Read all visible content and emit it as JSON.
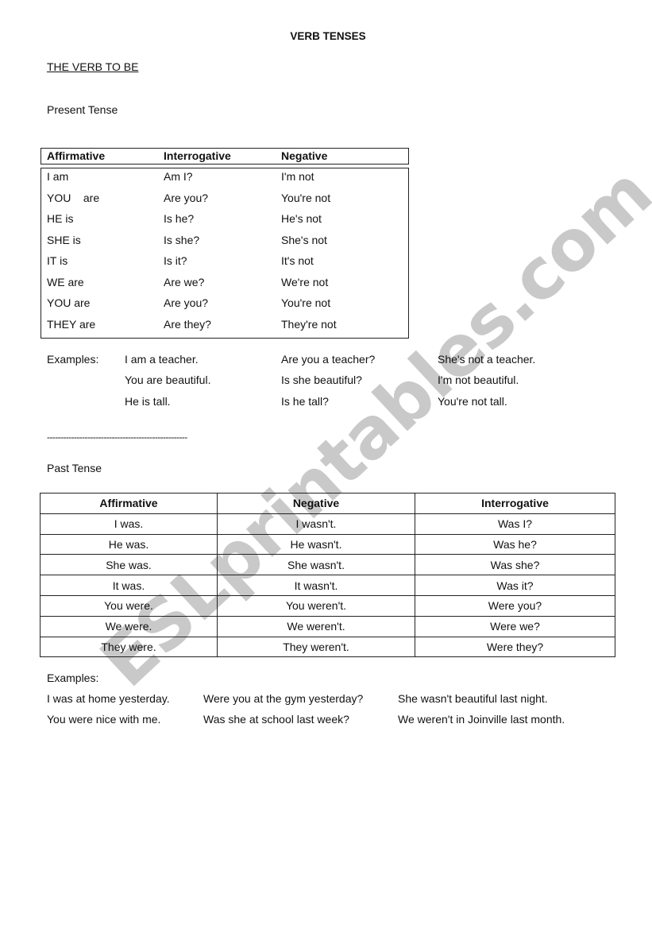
{
  "watermark": "ESLprintables.com",
  "title": "VERB TENSES",
  "subtitle": "THE VERB TO BE",
  "present": {
    "heading": "Present Tense",
    "columns": [
      "Affirmative",
      "Interrogative",
      "Negative"
    ],
    "rows": [
      [
        "I am",
        "Am I?",
        "I'm not"
      ],
      [
        "YOU    are",
        "Are you?",
        "You're not"
      ],
      [
        "HE is",
        "Is he?",
        "He's not"
      ],
      [
        "SHE is",
        "Is she?",
        "She's not"
      ],
      [
        "IT is",
        "Is it?",
        "It's not"
      ],
      [
        "WE are",
        "Are we?",
        "We're not"
      ],
      [
        "YOU are",
        "Are you?",
        "You're not"
      ],
      [
        "THEY are",
        "Are they?",
        "They're not"
      ]
    ],
    "examples_label": "Examples:",
    "examples": [
      [
        "I am a teacher.",
        "Are you a teacher?",
        "She's not a teacher."
      ],
      [
        "You are beautiful.",
        "Is she beautiful?",
        "I'm not beautiful."
      ],
      [
        "He is tall.",
        "Is he tall?",
        "You're not tall."
      ]
    ]
  },
  "divider": "----------------------------------------------------",
  "past": {
    "heading": "Past Tense",
    "columns": [
      "Affirmative",
      "Negative",
      "Interrogative"
    ],
    "rows": [
      [
        "I was.",
        "I wasn't.",
        "Was I?"
      ],
      [
        "He was.",
        "He wasn't.",
        "Was he?"
      ],
      [
        "She was.",
        "She wasn't.",
        "Was she?"
      ],
      [
        "It was.",
        "It wasn't.",
        "Was it?"
      ],
      [
        "You were.",
        "You weren't.",
        "Were you?"
      ],
      [
        "We were.",
        "We weren't.",
        "Were we?"
      ],
      [
        "They were.",
        "They weren't.",
        "Were they?"
      ]
    ],
    "examples_label": "Examples:",
    "examples": [
      [
        "I was at home yesterday.",
        "Were you at the gym yesterday?",
        "She wasn't beautiful last night."
      ],
      [
        "You were nice with me.",
        "Was she at school last week?",
        "We weren't in Joinville last month."
      ]
    ]
  }
}
